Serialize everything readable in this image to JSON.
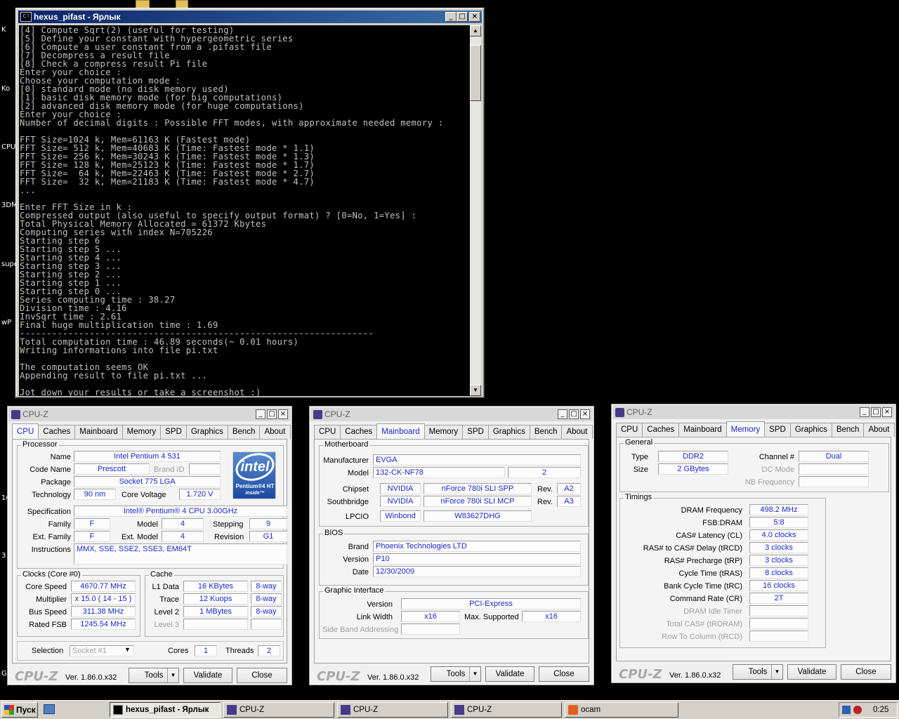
{
  "desktop": {
    "labels": [
      "K",
      "Ko",
      "CPU",
      "3DM",
      "supe",
      "wP",
      "16",
      "3",
      "G"
    ]
  },
  "console": {
    "title": "hexus_pifast - Ярлык",
    "lines": [
      "[4] Compute Sqrt(2) (useful for testing)",
      "[5] Define your constant with hypergeometric series",
      "[6] Compute a user constant from a .pifast file",
      "[7] Decompress a result file",
      "[8] Check a compress result Pi file",
      "Enter your choice :",
      "Choose your computation mode :",
      "[0] standard mode (no disk memory used)",
      "[1] basic disk memory mode (for big computations)",
      "[2] advanced disk memory mode (for huge computations)",
      "Enter your choice :",
      "Number of decimal digits : Possible FFT modes, with approximate needed memory :",
      "",
      "FFT Size=1024 k, Mem=61163 K (Fastest mode)",
      "FFT Size= 512 k, Mem=40683 K (Time: Fastest mode * 1.1)",
      "FFT Size= 256 k, Mem=30243 K (Time: Fastest mode * 1.3)",
      "FFT Size= 128 k, Mem=25123 K (Time: Fastest mode * 1.7)",
      "FFT Size=  64 k, Mem=22463 K (Time: Fastest mode * 2.7)",
      "FFT Size=  32 k, Mem=21183 K (Time: Fastest mode * 4.7)",
      "...",
      "",
      "Enter FFT Size in k :",
      "Compressed output (also useful to specify output format) ? [0=No, 1=Yes] :",
      "Total Physical Memory Allocated = 61372 Kbytes",
      "Computing series with index N=705226",
      "Starting step 6",
      "Starting step 5 ...",
      "Starting step 4 ...",
      "Starting step 3 ...",
      "Starting step 2 ...",
      "Starting step 1 ...",
      "Starting step 0 ...",
      "Series computing time : 38.27",
      "Division time : 4.16",
      "InvSqrt time : 2.61",
      "Final huge multiplication time : 1.69",
      "------------------------------------------------------------------",
      "Total computation time : 46.89 seconds(~ 0.01 hours)",
      "Writing informations into file pi.txt",
      "",
      "The computation seems OK",
      "Appending result to file pi.txt ...",
      "",
      "Jot down your results or take a screenshot :)"
    ]
  },
  "cpuz_common": {
    "title": "CPU-Z",
    "tabs": [
      "CPU",
      "Caches",
      "Mainboard",
      "Memory",
      "SPD",
      "Graphics",
      "Bench",
      "About"
    ],
    "logo": "CPU-Z",
    "version": "Ver. 1.86.0.x32",
    "tools": "Tools",
    "validate": "Validate",
    "close": "Close"
  },
  "cpu": {
    "processor_group": "Processor",
    "name_label": "Name",
    "name": "Intel Pentium 4 531",
    "codename_label": "Code Name",
    "codename": "Prescott",
    "brandid_label": "Brand ID",
    "package_label": "Package",
    "package": "Socket 775 LGA",
    "technology_label": "Technology",
    "technology": "90 nm",
    "corevoltage_label": "Core Voltage",
    "corevoltage": "1.720 V",
    "spec_label": "Specification",
    "spec": "Intel® Pentium® 4 CPU 3.00GHz",
    "family_label": "Family",
    "family": "F",
    "model_label": "Model",
    "model": "4",
    "stepping_label": "Stepping",
    "stepping": "9",
    "extfamily_label": "Ext. Family",
    "extfamily": "F",
    "extmodel_label": "Ext. Model",
    "extmodel": "4",
    "revision_label": "Revision",
    "revision": "G1",
    "instructions_label": "Instructions",
    "instructions": "MMX, SSE, SSE2, SSE3, EM64T",
    "clocks_group": "Clocks (Core #0)",
    "corespeed_label": "Core Speed",
    "corespeed": "4670.77 MHz",
    "multiplier_label": "Multiplier",
    "multiplier": "x 15.0 ( 14 - 15 )",
    "busspeed_label": "Bus Speed",
    "busspeed": "311.38 MHz",
    "ratedfsb_label": "Rated FSB",
    "ratedfsb": "1245.54 MHz",
    "cache_group": "Cache",
    "l1_label": "L1 Data",
    "l1": "16 KBytes",
    "l1way": "8-way",
    "trace_label": "Trace",
    "trace": "12 Kuops",
    "traceway": "8-way",
    "l2_label": "Level 2",
    "l2": "1 MBytes",
    "l2way": "8-way",
    "l3_label": "Level 3",
    "selection_label": "Selection",
    "selection": "Socket #1",
    "cores_label": "Cores",
    "cores": "1",
    "threads_label": "Threads",
    "threads": "2",
    "intel_logo": "intel",
    "intel_sub": "Pentium®4 HT",
    "intel_sub2": "inside™"
  },
  "mainboard": {
    "mb_group": "Motherboard",
    "manufacturer_label": "Manufacturer",
    "manufacturer": "EVGA",
    "model_label": "Model",
    "model": "132-CK-NF78",
    "model_rev": "2",
    "chipset_label": "Chipset",
    "chipset_vendor": "NVIDIA",
    "chipset": "nForce 780i SLI SPP",
    "chipset_rev_label": "Rev.",
    "chipset_rev": "A2",
    "sb_label": "Southbridge",
    "sb_vendor": "NVIDIA",
    "sb": "nForce 780i SLI MCP",
    "sb_rev_label": "Rev.",
    "sb_rev": "A3",
    "lpcio_label": "LPCIO",
    "lpcio_vendor": "Winbond",
    "lpcio": "W83627DHG",
    "bios_group": "BIOS",
    "brand_label": "Brand",
    "brand": "Phoenix Technologies LTD",
    "version_label": "Version",
    "version": "P10",
    "date_label": "Date",
    "date": "12/30/2009",
    "gi_group": "Graphic Interface",
    "gi_version_label": "Version",
    "gi_version": "PCI-Express",
    "linkwidth_label": "Link Width",
    "linkwidth": "x16",
    "maxsup_label": "Max. Supported",
    "maxsup": "x16",
    "sba_label": "Side Band Addressing"
  },
  "memory": {
    "general_group": "General",
    "type_label": "Type",
    "type": "DDR2",
    "channel_label": "Channel #",
    "channel": "Dual",
    "size_label": "Size",
    "size": "2 GBytes",
    "dcmode_label": "DC Mode",
    "nbfreq_label": "NB Frequency",
    "timings_group": "Timings",
    "dramfreq_label": "DRAM Frequency",
    "dramfreq": "498.2 MHz",
    "fsbdram_label": "FSB:DRAM",
    "fsbdram": "5:8",
    "cl_label": "CAS# Latency (CL)",
    "cl": "4.0 clocks",
    "trcd_label": "RAS# to CAS# Delay (tRCD)",
    "trcd": "3 clocks",
    "trp_label": "RAS# Precharge (tRP)",
    "trp": "3 clocks",
    "tras_label": "Cycle Time (tRAS)",
    "tras": "8 clocks",
    "trc_label": "Bank Cycle Time (tRC)",
    "trc": "16 clocks",
    "cr_label": "Command Rate (CR)",
    "cr": "2T",
    "idle_label": "DRAM Idle Timer",
    "trdram_label": "Total CAS# (tRDRAM)",
    "rtc_label": "Row To Column (tRCD)"
  },
  "taskbar": {
    "start": "Пуск",
    "items": [
      {
        "label": "hexus_pifast - Ярлык",
        "active": true
      },
      {
        "label": "CPU-Z",
        "active": false
      },
      {
        "label": "CPU-Z",
        "active": false
      },
      {
        "label": "CPU-Z",
        "active": false
      },
      {
        "label": "ocam",
        "active": false
      }
    ],
    "clock": "0:25"
  }
}
